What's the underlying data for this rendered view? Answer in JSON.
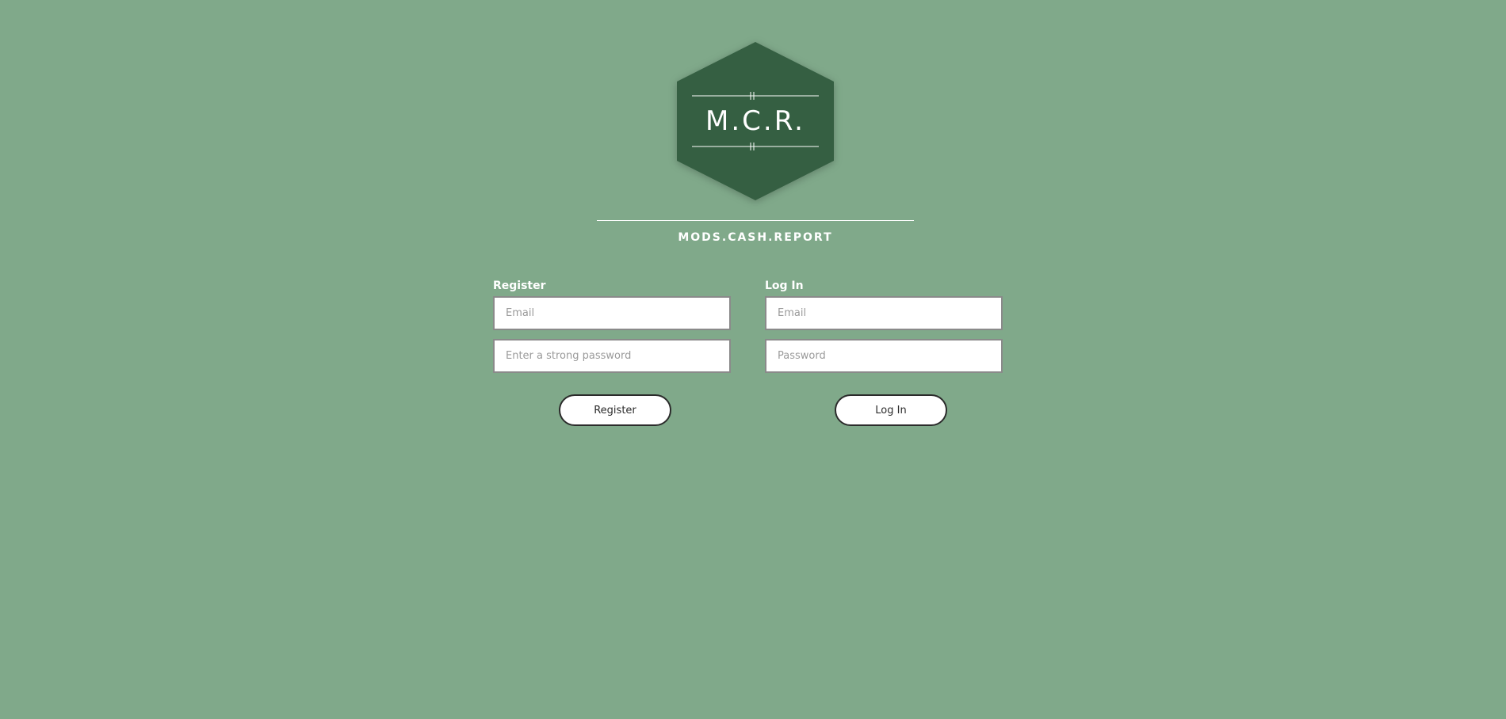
{
  "logo": {
    "text": "M.C.R.",
    "colors": {
      "hexagon": "#355e42",
      "lines": "#ffffff"
    }
  },
  "tagline": "MODS.CASH.REPORT",
  "register": {
    "heading": "Register",
    "email_placeholder": "Email",
    "password_placeholder": "Enter a strong password",
    "button_label": "Register"
  },
  "login": {
    "heading": "Log In",
    "email_placeholder": "Email",
    "password_placeholder": "Password",
    "button_label": "Log In"
  },
  "colors": {
    "background": "#80a98a",
    "button_border": "#2b2b2b",
    "input_border": "#8a8a8a"
  }
}
